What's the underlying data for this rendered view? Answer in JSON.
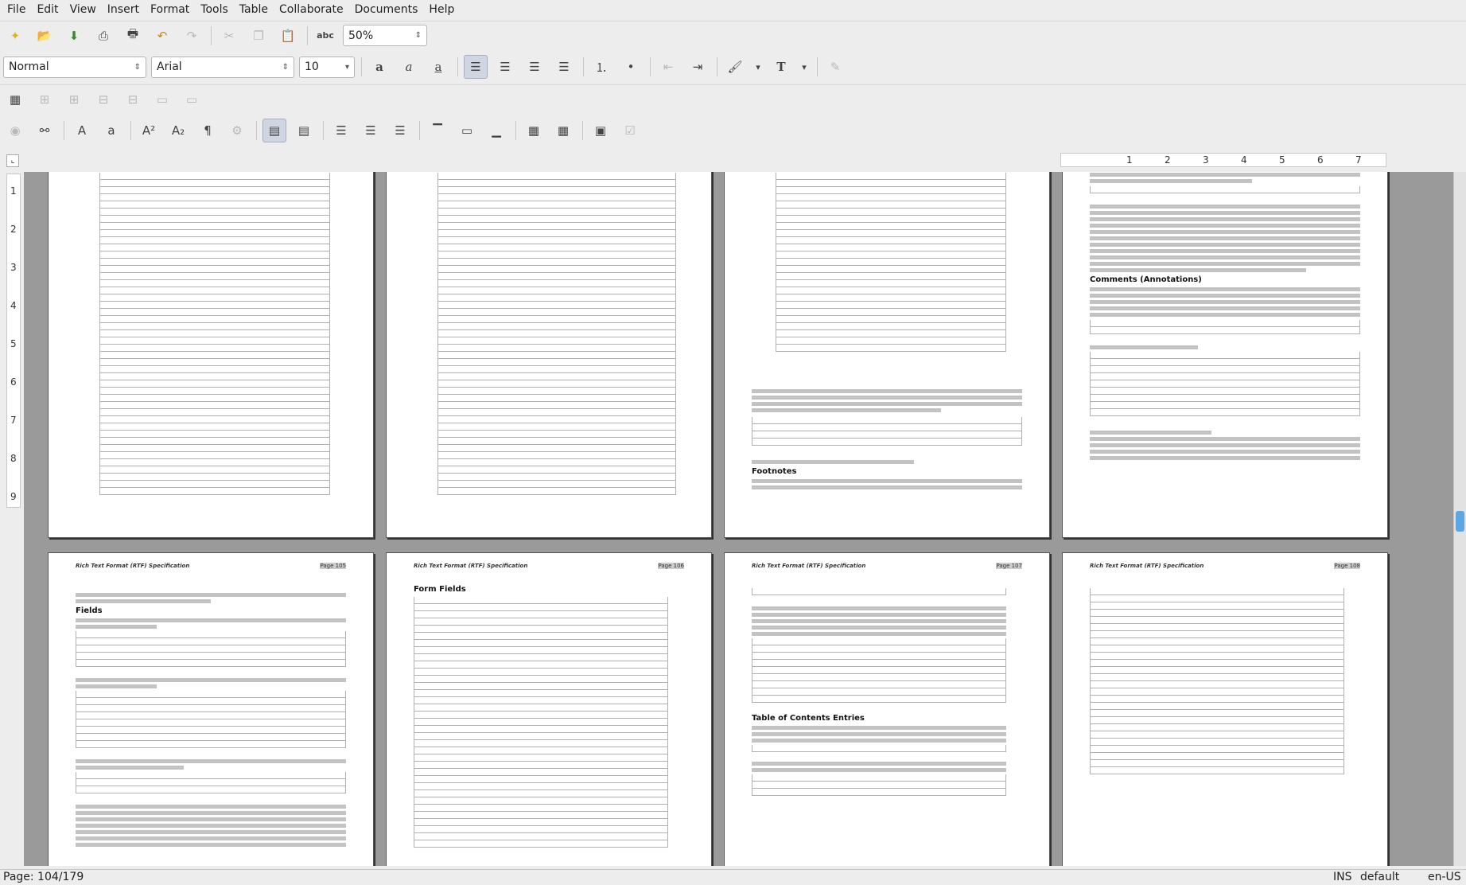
{
  "menu": [
    "File",
    "Edit",
    "View",
    "Insert",
    "Format",
    "Tools",
    "Table",
    "Collaborate",
    "Documents",
    "Help"
  ],
  "toolbar": {
    "zoom": "50%",
    "style": "Normal",
    "font": "Arial",
    "size": "10"
  },
  "ruler": {
    "h_numbers": [
      "1",
      "2",
      "3",
      "4",
      "5",
      "6",
      "7"
    ],
    "v_numbers": [
      "1",
      "2",
      "3",
      "4",
      "5",
      "6",
      "7",
      "8",
      "9"
    ]
  },
  "pages": {
    "header_title": "Rich Text Format (RTF) Specification",
    "p105": "Page 105",
    "p106": "Page 106",
    "p107": "Page 107",
    "p108": "Page 108",
    "fields_heading": "Fields",
    "form_fields_heading": "Form Fields",
    "toc_heading": "Table of Contents Entries",
    "footnotes_heading": "Footnotes",
    "comments_heading": "Comments (Annotations)"
  },
  "status": {
    "page": "Page: 104/179",
    "mode": "INS",
    "style": "default",
    "lang": "en-US"
  }
}
